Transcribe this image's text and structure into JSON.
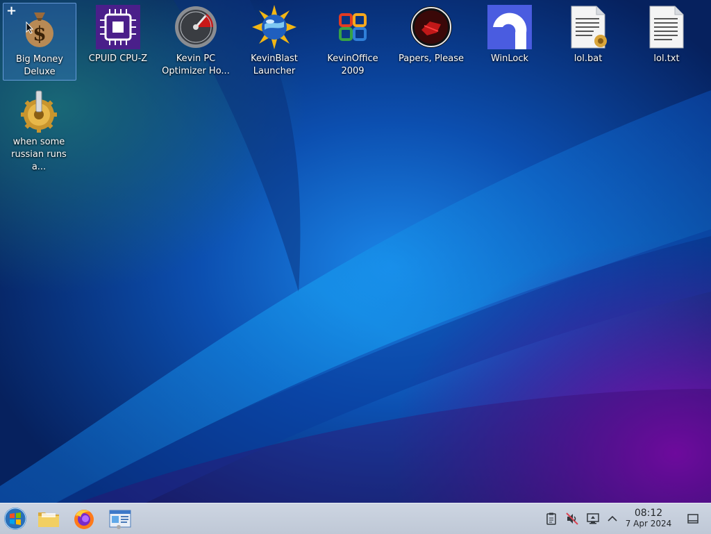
{
  "desktop": {
    "icons": [
      {
        "label": "Big Money Deluxe",
        "icon": "money-bag-icon"
      },
      {
        "label": "CPUID CPU-Z",
        "icon": "cpu-chip-icon"
      },
      {
        "label": "Kevin PC Optimizer Ho...",
        "icon": "speedometer-icon"
      },
      {
        "label": "KevinBlast Launcher",
        "icon": "globe-burst-icon"
      },
      {
        "label": "KevinOffice 2009",
        "icon": "office-logo-icon"
      },
      {
        "label": "Papers, Please",
        "icon": "red-seal-icon"
      },
      {
        "label": "WinLock",
        "icon": "lock-arc-icon"
      },
      {
        "label": "lol.bat",
        "icon": "batch-file-icon"
      },
      {
        "label": "lol.txt",
        "icon": "text-file-icon"
      },
      {
        "label": "when some russian runs a...",
        "icon": "gear-executable-icon"
      }
    ]
  },
  "taskbar": {
    "launchers": [
      {
        "name": "start-menu-button",
        "icon": "windows-orb-icon"
      },
      {
        "name": "file-manager-button",
        "icon": "folder-icon"
      },
      {
        "name": "firefox-button",
        "icon": "firefox-icon"
      },
      {
        "name": "system-settings-button",
        "icon": "settings-window-icon"
      }
    ],
    "tray": [
      "clipboard-icon",
      "speaker-muted-icon",
      "network-monitor-icon",
      "chevron-up-icon",
      "show-desktop-icon"
    ],
    "clock": {
      "time": "08:12",
      "date": "7 Apr 2024"
    }
  },
  "colors": {
    "taskbar_bg": "#c7cfdc",
    "selection": "#3d78c8",
    "wallpaper_dark": "#071a4a",
    "wallpaper_blue": "#1a7fe0",
    "wallpaper_purple": "#6a0aa0"
  }
}
